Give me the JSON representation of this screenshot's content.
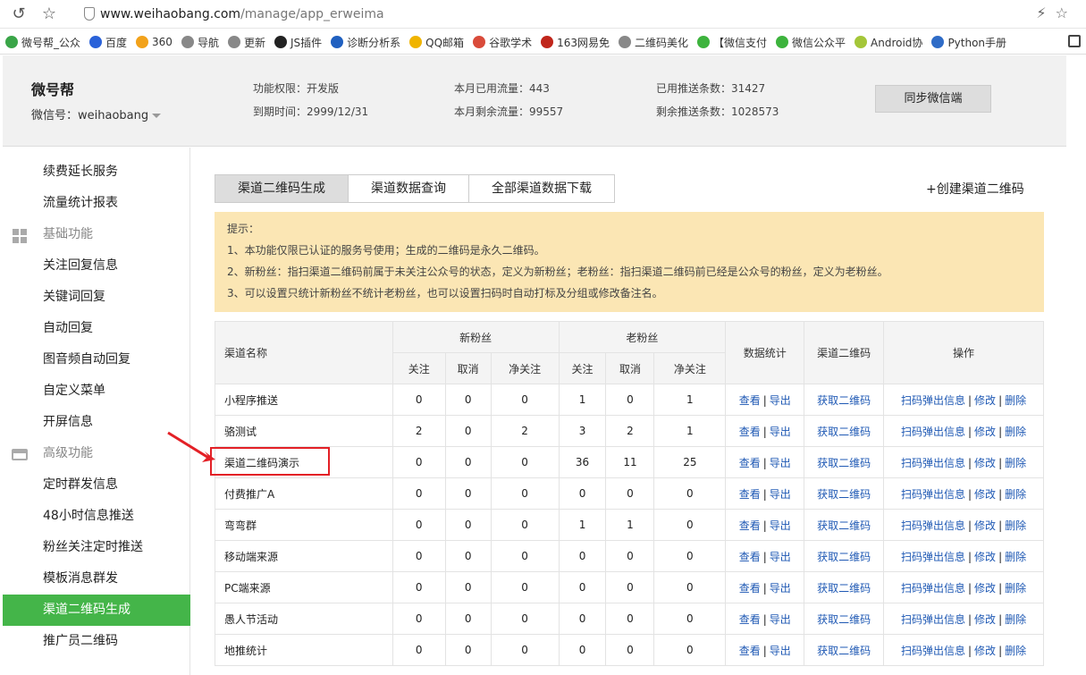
{
  "browser": {
    "url_host": "www.weihaobang.com",
    "url_path": "/manage/app_erweima",
    "bookmarks": [
      "微号帮_公众",
      "百度",
      "360",
      "导航",
      "更新",
      "JS插件",
      "诊断分析系",
      "QQ邮箱",
      "谷歌学术",
      "163网易免",
      "二维码美化",
      "【微信支付",
      "微信公众平",
      "Android协",
      "Python手册"
    ],
    "bookmark_colors": [
      "#3aa548",
      "#2a62d9",
      "#f2a21b",
      "#888888",
      "#888888",
      "#222222",
      "#2060c0",
      "#f0b400",
      "#d94b3a",
      "#c0261b",
      "#888888",
      "#3db33d",
      "#3db33d",
      "#a4c639",
      "#2f6cc7"
    ]
  },
  "header": {
    "brand": "微号帮",
    "wxid": "微信号：weihaobang",
    "func_perm": "功能权限：开发版",
    "expire": "到期时间：2999/12/31",
    "used_flow": "本月已用流量：443",
    "remain_flow": "本月剩余流量：99557",
    "used_push": "已用推送条数：31427",
    "remain_push": "剩余推送条数：1028573",
    "sync_button": "同步微信端"
  },
  "sidebar": {
    "items_top": [
      "续费延长服务",
      "流量统计报表"
    ],
    "section_basic": "基础功能",
    "items_basic": [
      "关注回复信息",
      "关键词回复",
      "自动回复",
      "图音频自动回复",
      "自定义菜单",
      "开屏信息"
    ],
    "section_advanced": "高级功能",
    "items_advanced": [
      "定时群发信息",
      "48小时信息推送",
      "粉丝关注定时推送",
      "模板消息群发",
      "渠道二维码生成",
      "推广员二维码"
    ],
    "active_item": "渠道二维码生成"
  },
  "tabs": [
    "渠道二维码生成",
    "渠道数据查询",
    "全部渠道数据下载"
  ],
  "create_link": "+创建渠道二维码",
  "notice": {
    "title": "提示：",
    "lines": [
      "1、本功能仅限已认证的服务号使用；生成的二维码是永久二维码。",
      "2、新粉丝：指扫渠道二维码前属于未关注公众号的状态，定义为新粉丝；老粉丝：指扫渠道二维码前已经是公众号的粉丝，定义为老粉丝。",
      "3、可以设置只统计新粉丝不统计老粉丝，也可以设置扫码时自动打标及分组或修改备注名。"
    ]
  },
  "table": {
    "headers": {
      "name": "渠道名称",
      "new_fans": "新粉丝",
      "old_fans": "老粉丝",
      "stats": "数据统计",
      "qrcode": "渠道二维码",
      "ops": "操作",
      "follow": "关注",
      "cancel": "取消",
      "net": "净关注"
    },
    "rows": [
      {
        "name": "小程序推送",
        "v": [
          "0",
          "0",
          "0",
          "1",
          "0",
          "1"
        ]
      },
      {
        "name": "骆测试",
        "v": [
          "2",
          "0",
          "2",
          "3",
          "2",
          "1"
        ]
      },
      {
        "name": "渠道二维码演示",
        "v": [
          "0",
          "0",
          "0",
          "36",
          "11",
          "25"
        ]
      },
      {
        "name": "付费推广A",
        "v": [
          "0",
          "0",
          "0",
          "0",
          "0",
          "0"
        ]
      },
      {
        "name": "弯弯群",
        "v": [
          "0",
          "0",
          "0",
          "1",
          "1",
          "0"
        ]
      },
      {
        "name": "移动端来源",
        "v": [
          "0",
          "0",
          "0",
          "0",
          "0",
          "0"
        ]
      },
      {
        "name": "PC端来源",
        "v": [
          "0",
          "0",
          "0",
          "0",
          "0",
          "0"
        ]
      },
      {
        "name": "愚人节活动",
        "v": [
          "0",
          "0",
          "0",
          "0",
          "0",
          "0"
        ]
      },
      {
        "name": "地推统计",
        "v": [
          "0",
          "0",
          "0",
          "0",
          "0",
          "0"
        ]
      }
    ],
    "link_view": "查看",
    "link_export": "导出",
    "link_get_qr": "获取二维码",
    "link_scan_info": "扫码弹出信息",
    "link_edit": "修改",
    "link_delete": "删除"
  },
  "colors": {
    "accent_green": "#44b549",
    "link_blue": "#1f59b4",
    "notice_bg": "#fbe6b4",
    "highlight_red": "#e32026"
  }
}
